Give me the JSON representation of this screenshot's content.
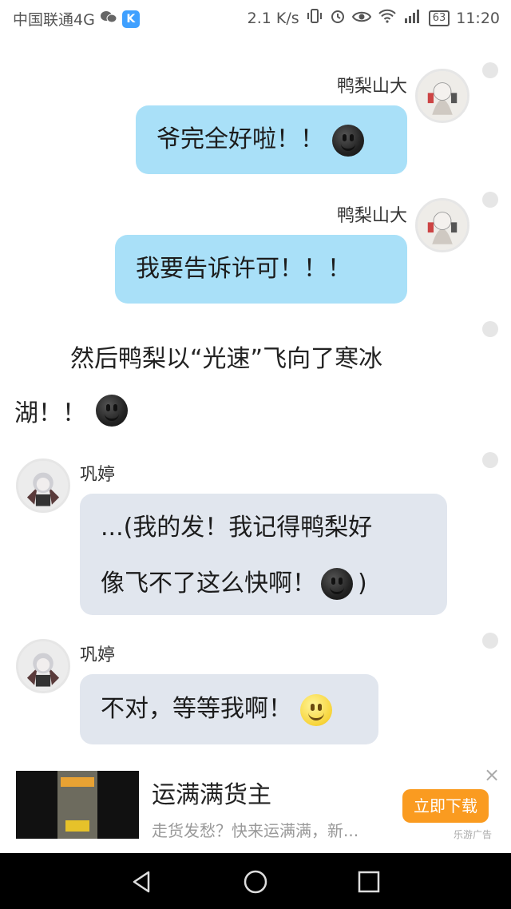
{
  "status_bar": {
    "carrier": "中国联通4G",
    "speed": "2.1 K/s",
    "battery": "63",
    "time": "11:20"
  },
  "messages": [
    {
      "sender": "鸭梨山大",
      "text": "爷完全好啦！！",
      "emoji": "dark-smile-emoji",
      "side": "right"
    },
    {
      "sender": "鸭梨山大",
      "text": "我要告诉许可！！！",
      "side": "right"
    },
    {
      "narration_line1": "然后鸭梨以“光速”飞向了寒冰",
      "narration_line2": "湖！！",
      "emoji": "dark-smile-emoji"
    },
    {
      "sender": "巩婷",
      "text_line1": "...(我的发！我记得鸭梨好",
      "text_line2": "像飞不了这么快啊！",
      "text_end": ")",
      "emoji": "dark-smile-emoji",
      "side": "left"
    },
    {
      "sender": "巩婷",
      "text": "不对，等等我啊！",
      "emoji": "yellow-smile-emoji",
      "side": "left"
    }
  ],
  "ad": {
    "title": "运满满货主",
    "description": "走货发愁？快来运满满，新...",
    "button_label": "立即下载",
    "tag": "乐游广告",
    "close": "×"
  },
  "colors": {
    "bubble_blue": "#a9e0f8",
    "bubble_gray": "#e1e6ee",
    "ad_button": "#fa9b20"
  }
}
